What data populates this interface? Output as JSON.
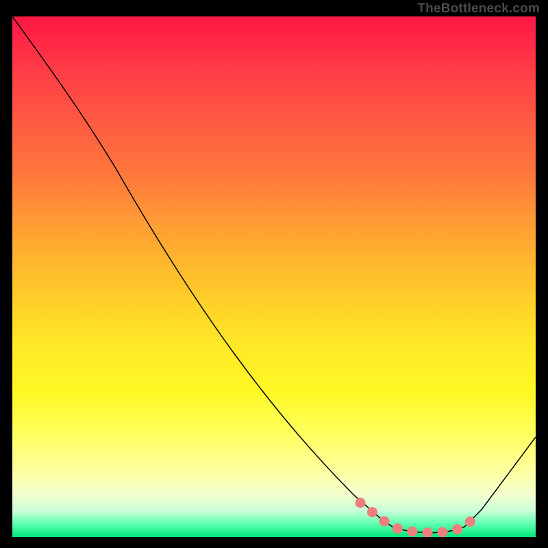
{
  "attribution": "TheBottleneck.com",
  "chart_data": {
    "type": "line",
    "title": "",
    "xlabel": "",
    "ylabel": "",
    "xlim": [
      0,
      100
    ],
    "ylim": [
      0,
      100
    ],
    "x": [
      0,
      5,
      10,
      15,
      20,
      25,
      30,
      35,
      40,
      45,
      50,
      55,
      60,
      65,
      68,
      72,
      75,
      78,
      82,
      86,
      90,
      95,
      100
    ],
    "values": [
      100,
      93,
      86,
      78,
      71,
      62,
      53,
      45,
      37,
      30,
      23,
      17,
      12,
      8,
      5,
      3,
      2,
      1.5,
      1,
      1.5,
      3,
      9,
      19
    ],
    "highlight_range_x": [
      66,
      89
    ],
    "gradient_stops": [
      {
        "pos": 0.0,
        "color": "#ff1744"
      },
      {
        "pos": 0.5,
        "color": "#ffd028"
      },
      {
        "pos": 0.8,
        "color": "#ffff5c"
      },
      {
        "pos": 1.0,
        "color": "#00e676"
      }
    ],
    "colors": {
      "curve": "#000000",
      "highlight": "#ef7f7d",
      "background_frame": "#000000"
    }
  }
}
